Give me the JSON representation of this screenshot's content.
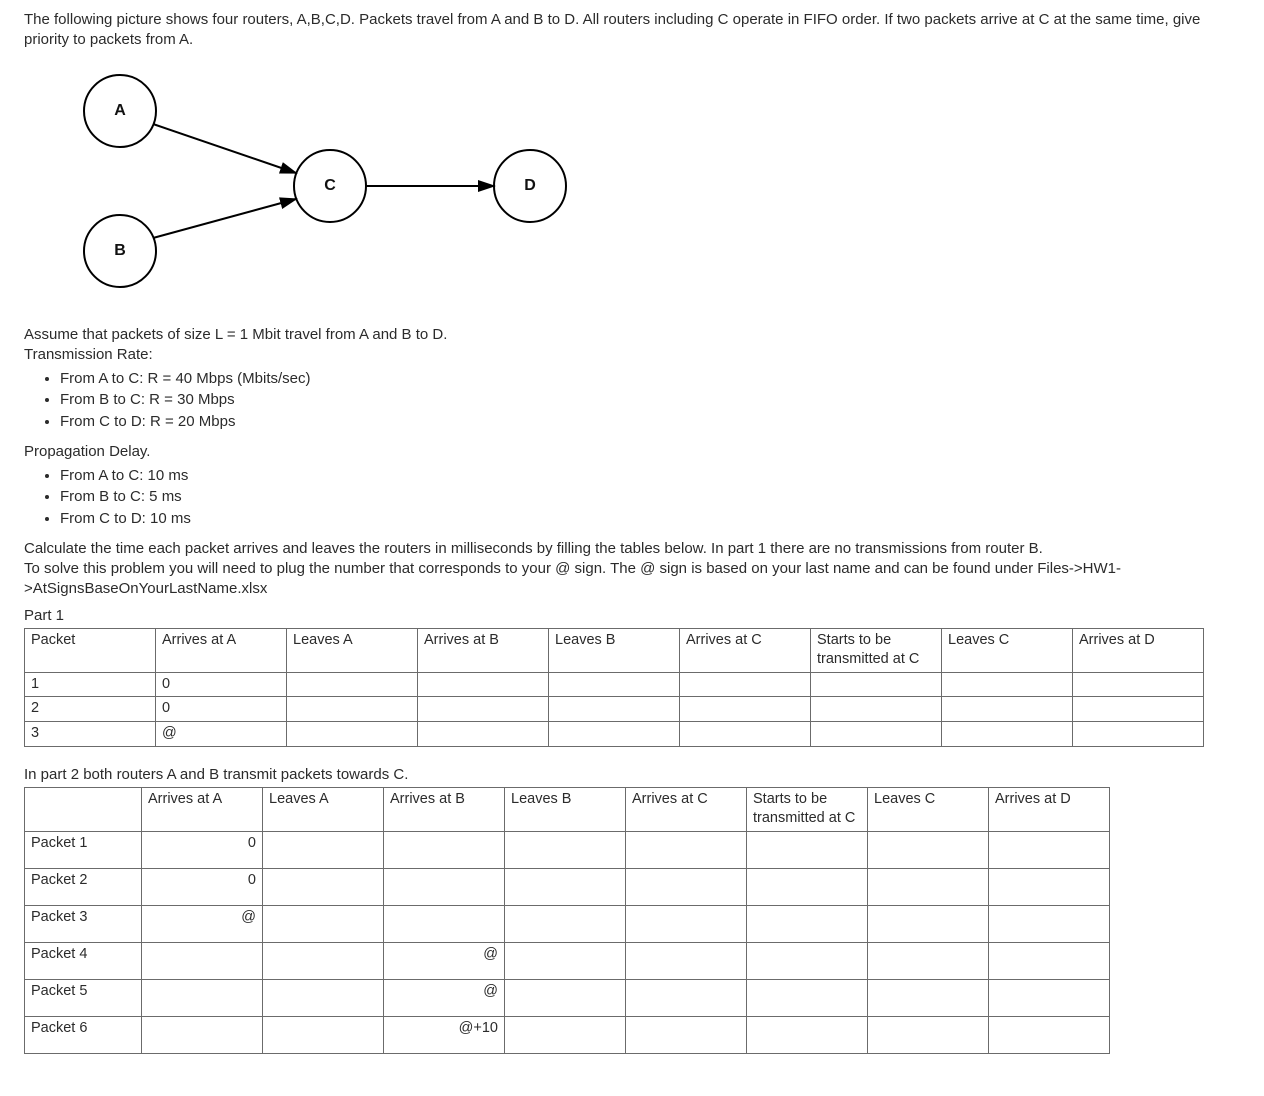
{
  "intro": "The following picture shows four routers, A,B,C,D. Packets travel from A and B to D. All routers including C operate in FIFO order. If two packets arrive at C at the same time, give priority to packets from A.",
  "diagram": {
    "nodes": {
      "A": "A",
      "B": "B",
      "C": "C",
      "D": "D"
    }
  },
  "assume": "Assume that packets of size L = 1 Mbit travel from A and B to D.",
  "trans_rate_heading": "Transmission Rate:",
  "trans_rates": [
    "From A to C:  R = 40 Mbps  (Mbits/sec)",
    "From B to C: R = 30 Mbps",
    "From C to D: R = 20 Mbps"
  ],
  "prop_delay_heading": "Propagation Delay.",
  "prop_delays": [
    "From A to C:  10 ms",
    "From B to C:    5 ms",
    "From C to D:  10 ms"
  ],
  "calc_text": "Calculate the time each packet arrives and leaves the routers in milliseconds by filling the tables below. In part 1 there are no transmissions from router B.",
  "at_sign_text": "To solve this problem you will need to plug the number that corresponds to your @ sign. The @ sign is based on your last name and can be found under Files->HW1->AtSignsBaseOnYourLastName.xlsx",
  "part1_label": "Part 1",
  "headers": {
    "packet": "Packet",
    "arrA": "Arrives at A",
    "leaveA": "Leaves A",
    "arrB": "Arrives at B",
    "leaveB": "Leaves B",
    "arrC": "Arrives at C",
    "startC": "Starts to be transmitted at C",
    "leaveC": "Leaves C",
    "arrD": "Arrives at D"
  },
  "part1_rows": [
    {
      "label": "1",
      "arrA": "0"
    },
    {
      "label": "2",
      "arrA": "0"
    },
    {
      "label": "3",
      "arrA": "@"
    }
  ],
  "part2_intro": "In part 2 both routers A and B transmit packets towards C.",
  "headers2": {
    "blank": "",
    "arrA": "Arrives at A",
    "leaveA": "Leaves A",
    "arrB": "Arrives at B",
    "leaveB": "Leaves B",
    "arrC": "Arrives at C",
    "startC": "Starts to be transmitted at C",
    "leaveC": "Leaves C",
    "arrD": "Arrives at D"
  },
  "part2_rows": [
    {
      "label": "Packet 1",
      "arrA": "0",
      "arrB": ""
    },
    {
      "label": "Packet 2",
      "arrA": "0",
      "arrB": ""
    },
    {
      "label": "Packet 3",
      "arrA": "@",
      "arrB": ""
    },
    {
      "label": "Packet 4",
      "arrA": "",
      "arrB": "@"
    },
    {
      "label": "Packet 5",
      "arrA": "",
      "arrB": "@"
    },
    {
      "label": "Packet 6",
      "arrA": "",
      "arrB": "@+10"
    }
  ]
}
